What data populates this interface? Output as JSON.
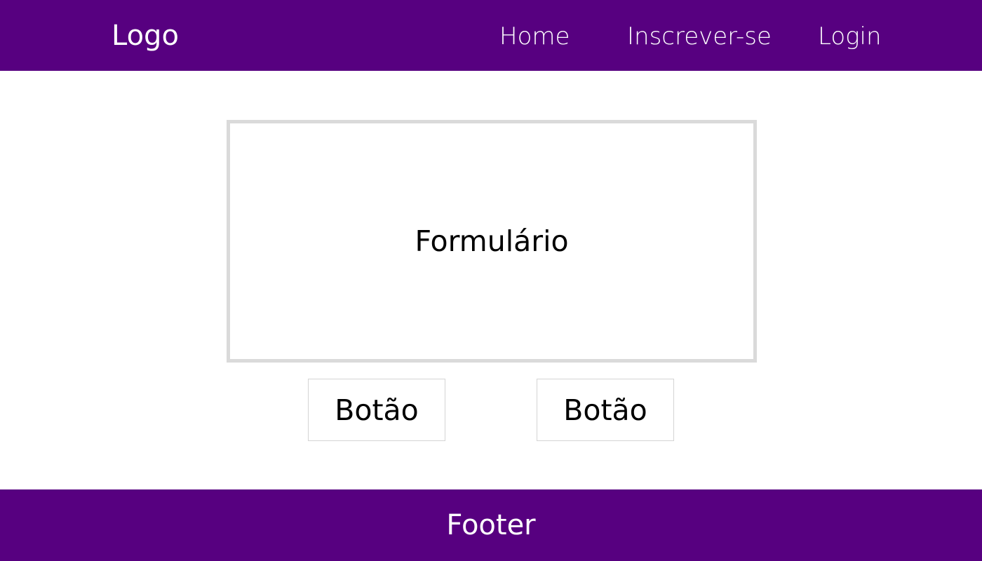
{
  "header": {
    "logo": "Logo",
    "nav": [
      {
        "label": "Home"
      },
      {
        "label": "Inscrever-se"
      },
      {
        "label": "Login"
      }
    ]
  },
  "main": {
    "form_label": "Formulário",
    "buttons": [
      {
        "label": "Botão"
      },
      {
        "label": "Botão"
      }
    ]
  },
  "footer": {
    "label": "Footer"
  },
  "colors": {
    "brand": "#570080",
    "border": "#dadada",
    "text_dark": "#000000",
    "text_light": "#ffffff"
  }
}
